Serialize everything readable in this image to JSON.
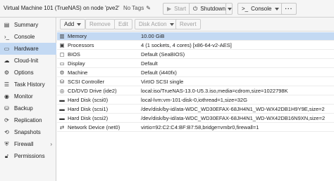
{
  "header": {
    "vm_title": "Virtual Machine 101 (TrueNAS) on node 'pve2'",
    "tags_label": "No Tags",
    "buttons": {
      "start": "Start",
      "shutdown": "Shutdown",
      "console": "Console"
    }
  },
  "sidebar": {
    "items": [
      {
        "label": "Summary",
        "icon": "summary-icon"
      },
      {
        "label": "Console",
        "icon": "console-icon"
      },
      {
        "label": "Hardware",
        "icon": "hardware-icon"
      },
      {
        "label": "Cloud-Init",
        "icon": "cloud-icon"
      },
      {
        "label": "Options",
        "icon": "gear-icon"
      },
      {
        "label": "Task History",
        "icon": "list-icon"
      },
      {
        "label": "Monitor",
        "icon": "eye-icon"
      },
      {
        "label": "Backup",
        "icon": "backup-icon"
      },
      {
        "label": "Replication",
        "icon": "refresh-icon"
      },
      {
        "label": "Snapshots",
        "icon": "history-icon"
      },
      {
        "label": "Firewall",
        "icon": "shield-icon"
      },
      {
        "label": "Permissions",
        "icon": "unlock-icon"
      }
    ],
    "active_index": 2
  },
  "toolbar": {
    "add": "Add",
    "remove": "Remove",
    "edit": "Edit",
    "disk_action": "Disk Action",
    "revert": "Revert"
  },
  "hardware": {
    "rows": [
      {
        "name": "Memory",
        "value": "10.00 GiB",
        "icon": "memory-icon"
      },
      {
        "name": "Processors",
        "value": "4 (1 sockets, 4 cores) [x86-64-v2-AES]",
        "icon": "cpu-icon"
      },
      {
        "name": "BIOS",
        "value": "Default (SeaBIOS)",
        "icon": "bios-icon"
      },
      {
        "name": "Display",
        "value": "Default",
        "icon": "display-icon"
      },
      {
        "name": "Machine",
        "value": "Default (i440fx)",
        "icon": "machine-icon"
      },
      {
        "name": "SCSI Controller",
        "value": "VirtIO SCSI single",
        "icon": "database-icon"
      },
      {
        "name": "CD/DVD Drive (ide2)",
        "value": "local:iso/TrueNAS-13.0-U5.3.iso,media=cdrom,size=1022798K",
        "icon": "cdrom-icon"
      },
      {
        "name": "Hard Disk (scsi0)",
        "value": "local-lvm:vm-101-disk-0,iothread=1,size=32G",
        "icon": "harddisk-icon"
      },
      {
        "name": "Hard Disk (scsi1)",
        "value": "/dev/disk/by-id/ata-WDC_WD30EFAX-68JH4N1_WD-WX42DB1H9Y9E,size=2",
        "icon": "harddisk-icon"
      },
      {
        "name": "Hard Disk (scsi2)",
        "value": "/dev/disk/by-id/ata-WDC_WD30EFAX-68JH4N1_WD-WX42DB16N9XN,size=2",
        "icon": "harddisk-icon"
      },
      {
        "name": "Network Device (net0)",
        "value": "virtio=92:C2:C4:BF:B7:58,bridge=vmbr0,firewall=1",
        "icon": "network-icon"
      }
    ],
    "selected_index": 0
  }
}
